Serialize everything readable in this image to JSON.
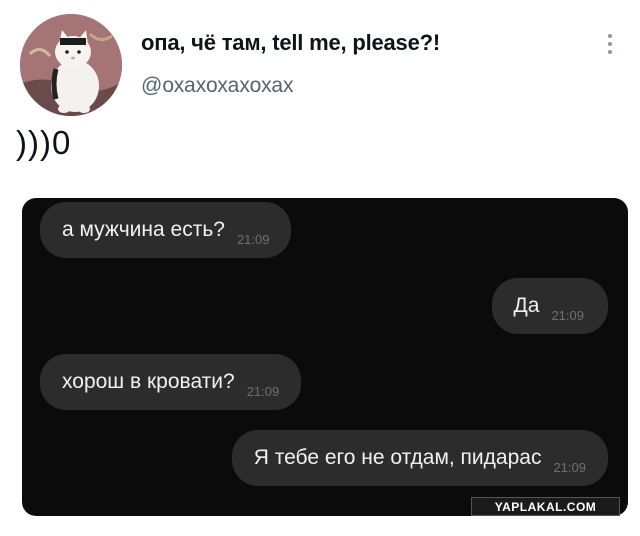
{
  "tweet": {
    "author_name": "опа, чё там, tell me, please?!",
    "author_handle": "@охахохахохах",
    "text": ")))0",
    "avatar_icon": "cat-avatar-icon",
    "more_icon": "more-options-icon"
  },
  "chat": {
    "messages": [
      {
        "side": "incoming",
        "text": "а мужчина есть?",
        "time": "21:09"
      },
      {
        "side": "outgoing",
        "text": "Да",
        "time": "21:09"
      },
      {
        "side": "incoming",
        "text": "хорош в кровати?",
        "time": "21:09"
      },
      {
        "side": "outgoing",
        "text": "Я тебе его не отдам, пидарас",
        "time": "21:09"
      }
    ]
  },
  "watermark": "YAPLAKAL.COM",
  "colors": {
    "chat_background": "#0b0b0b",
    "bubble": "#2c2c2c",
    "handle": "#536471"
  }
}
